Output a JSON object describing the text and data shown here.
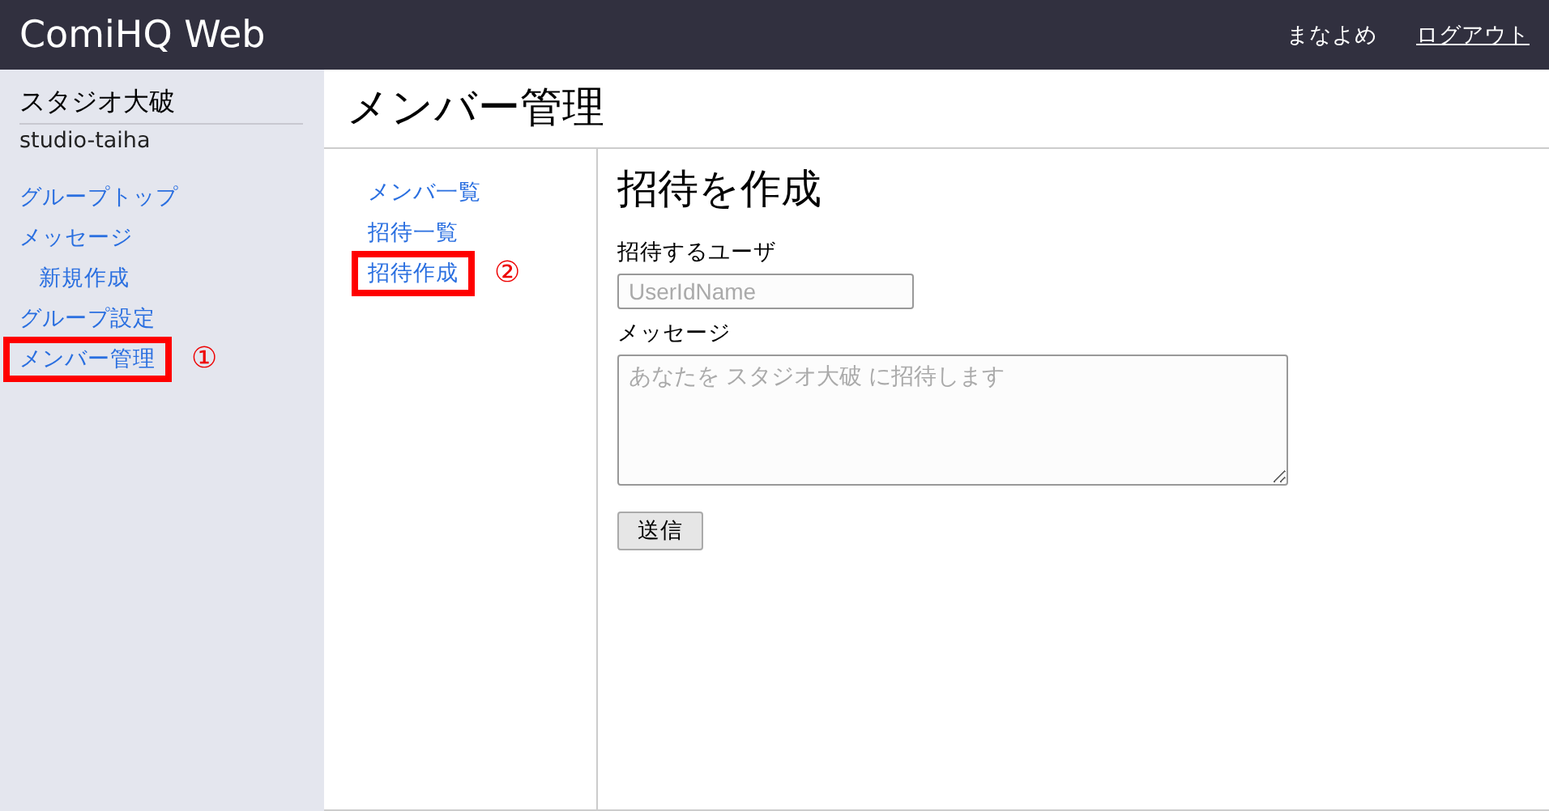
{
  "header": {
    "title": "ComiHQ Web",
    "user": "まなよめ",
    "logout": "ログアウト"
  },
  "sidebar": {
    "group_name": "スタジオ大破",
    "group_id": "studio-taiha",
    "items": [
      {
        "label": "グループトップ",
        "highlighted": false
      },
      {
        "label": "メッセージ",
        "highlighted": false,
        "children": [
          {
            "label": "新規作成",
            "highlighted": false
          }
        ]
      },
      {
        "label": "グループ設定",
        "highlighted": false
      },
      {
        "label": "メンバー管理",
        "highlighted": true,
        "callout": "①"
      }
    ]
  },
  "page_title": "メンバー管理",
  "subnav": {
    "items": [
      {
        "label": "メンバ一覧",
        "highlighted": false
      },
      {
        "label": "招待一覧",
        "highlighted": false
      },
      {
        "label": "招待作成",
        "highlighted": true,
        "callout": "②"
      }
    ]
  },
  "form": {
    "heading": "招待を作成",
    "user_label": "招待するユーザ",
    "user_placeholder": "UserIdName",
    "message_label": "メッセージ",
    "message_placeholder": "あなたを スタジオ大破 に招待します",
    "submit": "送信"
  }
}
